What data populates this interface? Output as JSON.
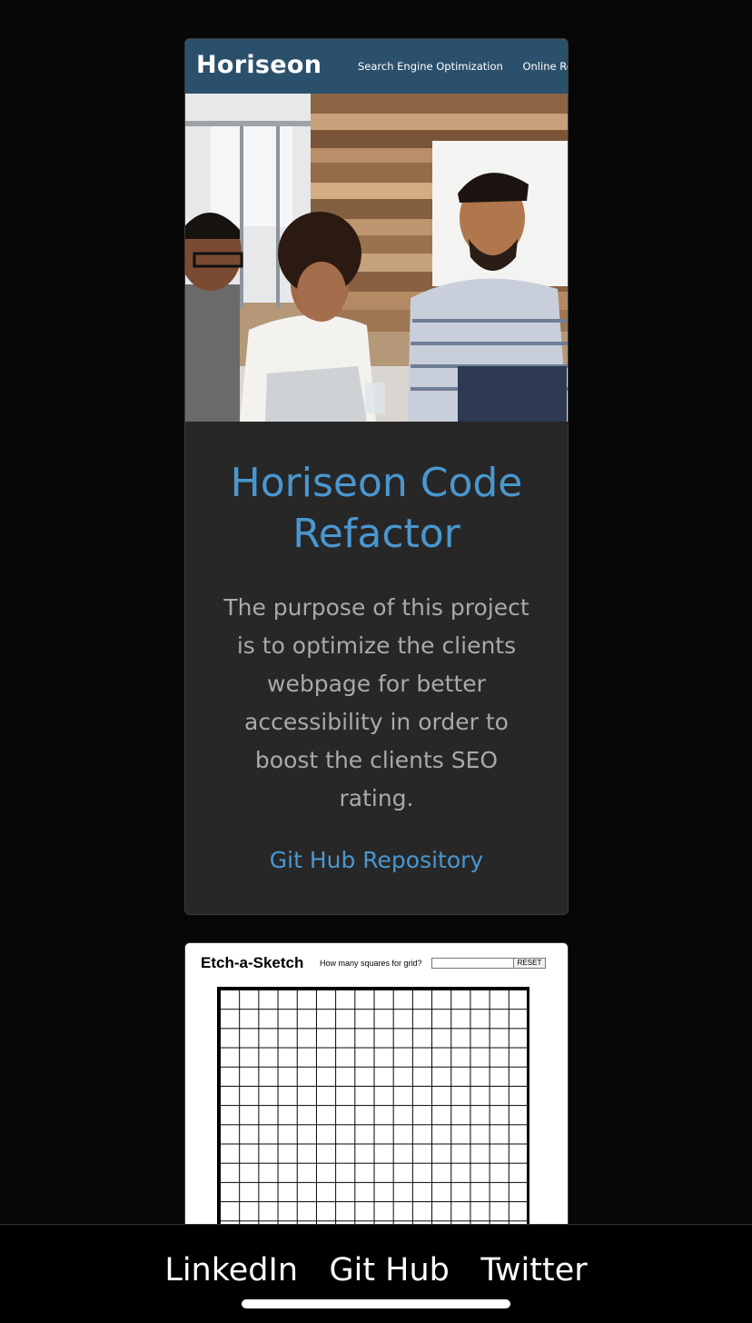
{
  "projects": [
    {
      "site_logo": "Horiseon",
      "site_nav": [
        "Search Engine Optimization",
        "Online Reputati"
      ],
      "title": "Horiseon Code Refactor",
      "description": "The purpose of this project is to optimize the clients webpage for better accessibility in order to boost the clients SEO rating.",
      "link_label": "Git Hub Repository"
    },
    {
      "app_title": "Etch-a-Sketch",
      "grid_prompt": "How many squares for grid?",
      "reset_label": "RESET"
    }
  ],
  "footer": {
    "links": [
      "LinkedIn",
      "Git Hub",
      "Twitter"
    ]
  },
  "colors": {
    "background": "#070707",
    "card": "#272727",
    "accent": "#4a97d0",
    "body_text": "#a9a9a9",
    "site_header": "#2b506b"
  }
}
